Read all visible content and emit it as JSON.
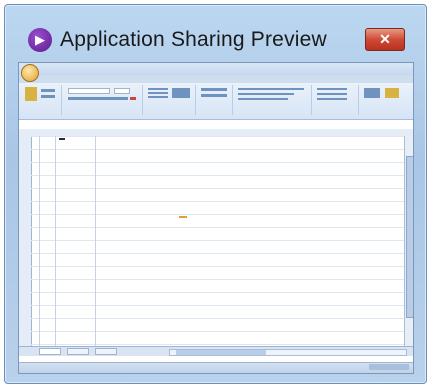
{
  "window": {
    "title": "Application Sharing Preview",
    "close_glyph": "✕",
    "icon": "app-sharing-icon"
  },
  "colors": {
    "frame": "#b6cfe9",
    "close_button": "#cf4a35",
    "accent": "#5a1a8c"
  }
}
